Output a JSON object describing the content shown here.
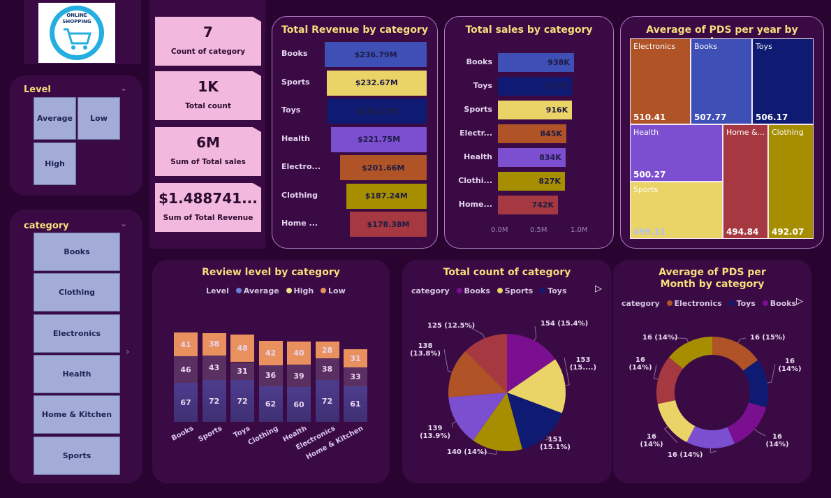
{
  "logo": {
    "text_top": "ONLINE",
    "text_bottom": "SHOPPING"
  },
  "level_slicer": {
    "title": "Level",
    "items": [
      "Average",
      "Low",
      "High"
    ]
  },
  "category_slicer": {
    "title": "category",
    "items": [
      "Books",
      "Clothing",
      "Electronics",
      "Health",
      "Home & Kitchen",
      "Sports"
    ]
  },
  "cards": [
    {
      "value": "7",
      "label": "Count of category"
    },
    {
      "value": "1K",
      "label": "Total count"
    },
    {
      "value": "6M",
      "label": "Sum of Total sales"
    },
    {
      "value": "$1.488741...",
      "label": "Sum of Total Revenue"
    }
  ],
  "colors": {
    "electronics": "#b05327",
    "books": "#3e4fb5",
    "toys": "#0f1b73",
    "health": "#7b4fd0",
    "home": "#a53840",
    "clothing": "#a68e00",
    "sports": "#ead468",
    "average": "#4b3a88",
    "high": "#5a2f62",
    "low": "#e8915e"
  },
  "chart_data": [
    {
      "type": "bar",
      "title": "Total Revenue by category",
      "categories": [
        "Books",
        "Sports",
        "Toys",
        "Health",
        "Electro...",
        "Clothing",
        "Home ..."
      ],
      "values": [
        236.79,
        232.67,
        230.25,
        221.75,
        201.66,
        187.24,
        178.38
      ],
      "labels": [
        "$236.79M",
        "$232.67M",
        "$230.25M",
        "$221.75M",
        "$201.66M",
        "$187.24M",
        "$178.38M"
      ]
    },
    {
      "type": "bar",
      "title": "Total sales by category",
      "categories": [
        "Books",
        "Toys",
        "Sports",
        "Electr...",
        "Health",
        "Clothi...",
        "Home..."
      ],
      "values": [
        938,
        917,
        916,
        845,
        834,
        827,
        742
      ],
      "labels": [
        "938K",
        "917K",
        "916K",
        "845K",
        "834K",
        "827K",
        "742K"
      ],
      "xticks": [
        "0.0M",
        "0.5M",
        "1.0M"
      ],
      "xlim": [
        0,
        1000
      ]
    },
    {
      "type": "treemap",
      "title": "Average of PDS per year by category",
      "items": [
        {
          "name": "Electronics",
          "value": "510.41"
        },
        {
          "name": "Books",
          "value": "507.77"
        },
        {
          "name": "Toys",
          "value": "506.17"
        },
        {
          "name": "Health",
          "value": "500.27"
        },
        {
          "name": "Home &...",
          "value": "494.84"
        },
        {
          "name": "Clothing",
          "value": "492.07"
        },
        {
          "name": "Sports",
          "value": "499.11"
        }
      ]
    },
    {
      "type": "bar",
      "stacked": true,
      "title": "Review level by category",
      "legend_title": "Level",
      "categories": [
        "Books",
        "Sports",
        "Toys",
        "Clothing",
        "Health",
        "Electronics",
        "Home & Kitchen"
      ],
      "series": [
        {
          "name": "Average",
          "values": [
            67,
            72,
            72,
            62,
            60,
            72,
            61
          ]
        },
        {
          "name": "High",
          "values": [
            46,
            43,
            31,
            36,
            39,
            38,
            33
          ]
        },
        {
          "name": "Low",
          "values": [
            41,
            38,
            48,
            42,
            40,
            28,
            31
          ]
        }
      ]
    },
    {
      "type": "pie",
      "title": "Total count of category",
      "legend_title": "category",
      "legend": [
        "Books",
        "Sports",
        "Toys"
      ],
      "slices": [
        {
          "label": "154 (15.4%)",
          "value": 154
        },
        {
          "label": "153 (15....)",
          "value": 153
        },
        {
          "label": "151 (15.1%)",
          "value": 151
        },
        {
          "label": "140 (14%)",
          "value": 140
        },
        {
          "label": "139 (13.9%)",
          "value": 139
        },
        {
          "label": "138 (13.8%)",
          "value": 138
        },
        {
          "label": "125 (12.5%)",
          "value": 125
        }
      ]
    },
    {
      "type": "pie",
      "donut": true,
      "title": "Average of PDS per Month by category",
      "legend_title": "category",
      "legend": [
        "Electronics",
        "Toys",
        "Books"
      ],
      "slices": [
        {
          "label": "16 (15%)",
          "value": 15
        },
        {
          "label": "16 (14%)",
          "value": 14
        },
        {
          "label": "16 (14%)",
          "value": 14
        },
        {
          "label": "16 (14%)",
          "value": 14
        },
        {
          "label": "16 (14%)",
          "value": 14
        },
        {
          "label": "16 (14%)",
          "value": 14
        },
        {
          "label": "16 (14%)",
          "value": 14
        }
      ]
    }
  ]
}
